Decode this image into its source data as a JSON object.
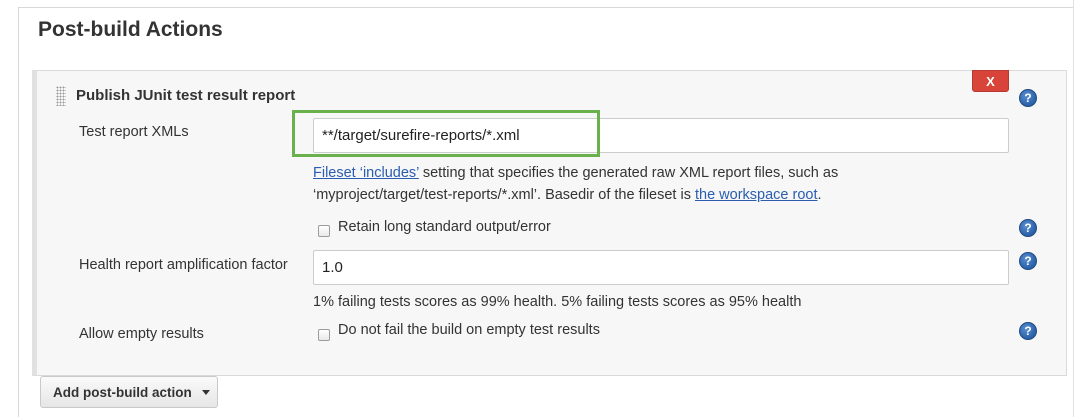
{
  "section_title": "Post-build Actions",
  "publisher": {
    "title": "Publish JUnit test result report",
    "delete_label": "X",
    "help_glyph": "?",
    "test_report": {
      "label": "Test report XMLs",
      "value": "**/target/surefire-reports/*.xml",
      "help_link_1": "Fileset ‘includes’",
      "help_text_1": " setting that specifies the generated raw XML report files, such as",
      "help_text_2": "‘myproject/target/test-reports/*.xml’. Basedir of the fileset is ",
      "help_link_2": "the workspace root",
      "help_text_3": "."
    },
    "retain_output": {
      "label": "Retain long standard output/error",
      "checked": false
    },
    "health_factor": {
      "label": "Health report amplification factor",
      "value": "1.0",
      "description": "1% failing tests scores as 99% health. 5% failing tests scores as 95% health"
    },
    "allow_empty": {
      "label": "Allow empty results",
      "checkbox_label": "Do not fail the build on empty test results",
      "checked": false
    }
  },
  "add_action_label": "Add post-build action",
  "colors": {
    "highlight": "#6ab04c",
    "delete": "#d9443a",
    "link": "#2a5db0",
    "help_icon": "#2f67b0"
  },
  "icons": {
    "help": "help-circle-icon",
    "drag": "drag-handle-icon",
    "dropdown": "caret-down-icon"
  }
}
